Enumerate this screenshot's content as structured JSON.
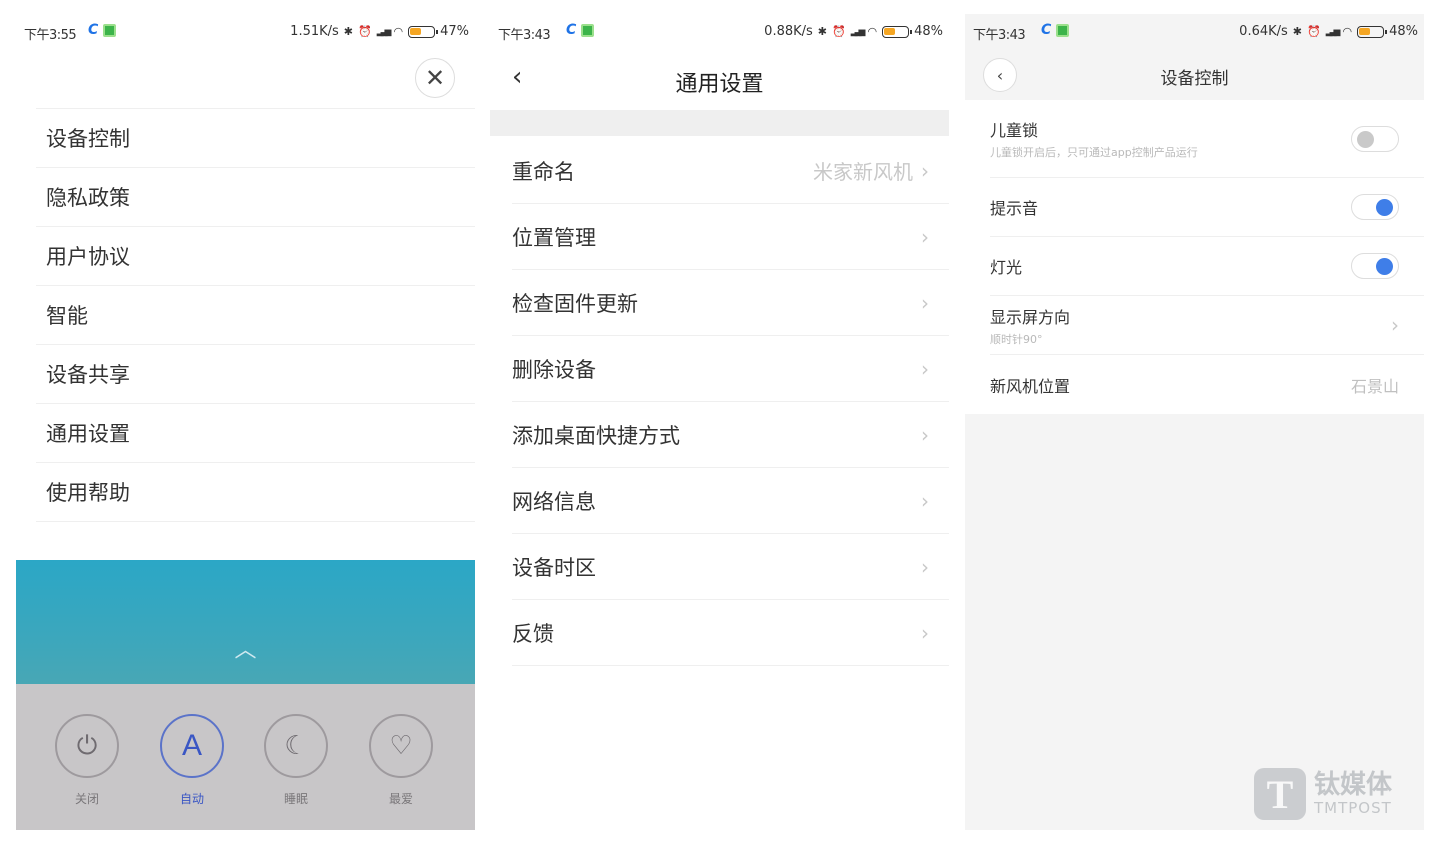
{
  "screens": [
    {
      "status": {
        "time": "下午3:55",
        "speed": "1.51K/s",
        "battery": "47%"
      },
      "menu": [
        "设备控制",
        "隐私政策",
        "用户协议",
        "智能",
        "设备共享",
        "通用设置",
        "使用帮助"
      ],
      "modes": [
        {
          "label": "关闭",
          "icon": "power-icon"
        },
        {
          "label": "自动",
          "icon": "auto-icon"
        },
        {
          "label": "睡眠",
          "icon": "moon-icon"
        },
        {
          "label": "最爱",
          "icon": "heart-icon"
        }
      ],
      "active_mode": "自动"
    },
    {
      "status": {
        "time": "下午3:43",
        "speed": "0.88K/s",
        "battery": "48%"
      },
      "title": "通用设置",
      "rows": [
        {
          "label": "重命名",
          "value": "米家新风机"
        },
        {
          "label": "位置管理",
          "value": ""
        },
        {
          "label": "检查固件更新",
          "value": ""
        },
        {
          "label": "删除设备",
          "value": ""
        },
        {
          "label": "添加桌面快捷方式",
          "value": ""
        },
        {
          "label": "网络信息",
          "value": ""
        },
        {
          "label": "设备时区",
          "value": ""
        },
        {
          "label": "反馈",
          "value": ""
        }
      ]
    },
    {
      "status": {
        "time": "下午3:43",
        "speed": "0.64K/s",
        "battery": "48%"
      },
      "title": "设备控制",
      "child_lock": {
        "label": "儿童锁",
        "sub": "儿童锁开启后，只可通过app控制产品运行",
        "on": false
      },
      "sound": {
        "label": "提示音",
        "on": true
      },
      "light": {
        "label": "灯光",
        "on": true
      },
      "orientation": {
        "label": "显示屏方向",
        "sub": "顺时针90°"
      },
      "location": {
        "label": "新风机位置",
        "value": "石景山"
      }
    }
  ],
  "watermark": {
    "cn": "钛媒体",
    "en": "TMTPOST",
    "logo_letter": "T"
  },
  "colors": {
    "accent_blue": "#3f7ee8",
    "teal": "#2ba7c6",
    "mode_active": "#3a56c4"
  }
}
